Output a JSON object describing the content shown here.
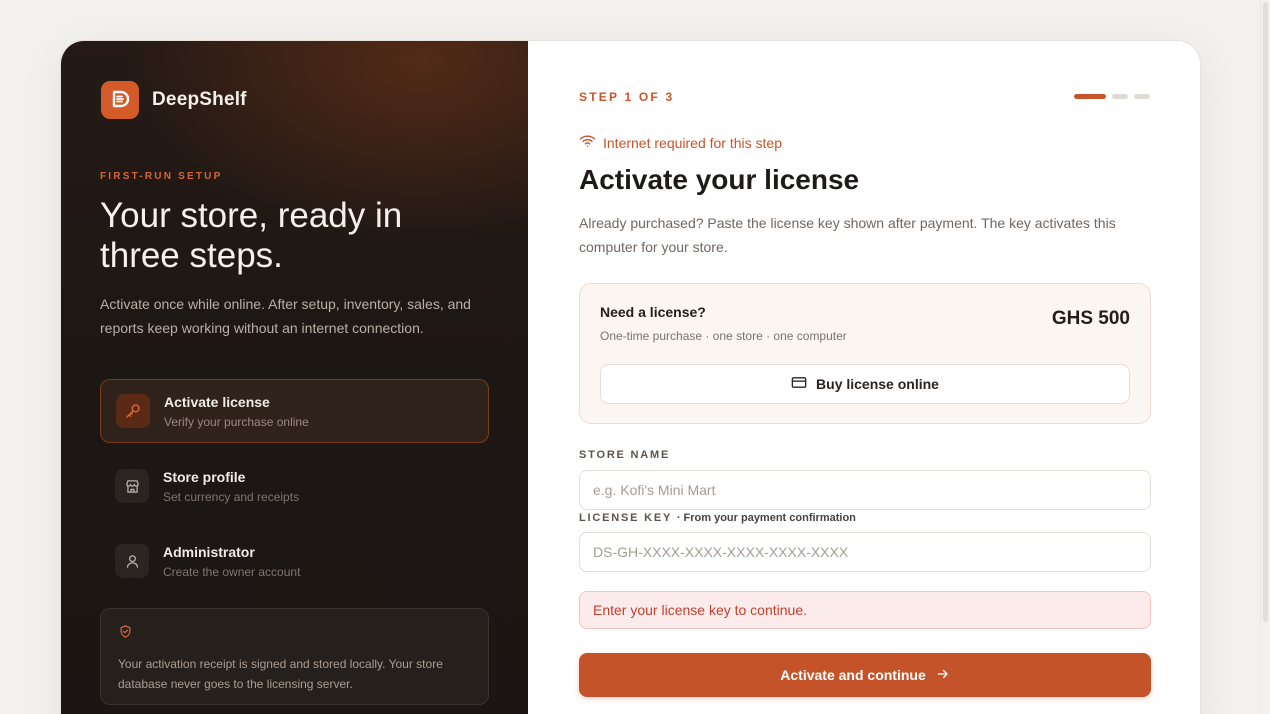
{
  "brand": {
    "name": "DeepShelf",
    "accent": "#d45a2a"
  },
  "left": {
    "eyebrow": "FIRST-RUN SETUP",
    "headline": "Your store, ready in three steps.",
    "lead": "Activate once while online. After setup, inventory, sales, and reports keep working without an internet connection.",
    "steps": [
      {
        "title": "Activate license",
        "subtitle": "Verify your purchase online",
        "icon": "key-icon",
        "active": true
      },
      {
        "title": "Store profile",
        "subtitle": "Set currency and receipts",
        "icon": "store-icon",
        "active": false
      },
      {
        "title": "Administrator",
        "subtitle": "Create the owner account",
        "icon": "user-icon",
        "active": false
      }
    ],
    "note": {
      "icon": "shield-check-icon",
      "text": "Your activation receipt is signed and stored locally. Your store database never goes to the licensing server."
    }
  },
  "right": {
    "step_label": "STEP 1 OF 3",
    "progress": {
      "current": 1,
      "total": 3
    },
    "network_notice": "Internet required for this step",
    "title": "Activate your license",
    "description": "Already purchased? Paste the license key shown after payment. The key activates this computer for your store.",
    "license_box": {
      "title": "Need a license?",
      "subtitle": "One-time purchase · one store · one computer",
      "price": "GHS 500",
      "buy_label": "Buy license online"
    },
    "store_name": {
      "label": "STORE NAME",
      "placeholder": "e.g. Kofi's Mini Mart",
      "value": ""
    },
    "license_key": {
      "label": "LICENSE KEY",
      "hint": "· From your payment confirmation",
      "placeholder": "DS-GH-XXXX-XXXX-XXXX-XXXX-XXXX",
      "value": ""
    },
    "error": "Enter your license key to continue.",
    "cta": "Activate and continue"
  }
}
